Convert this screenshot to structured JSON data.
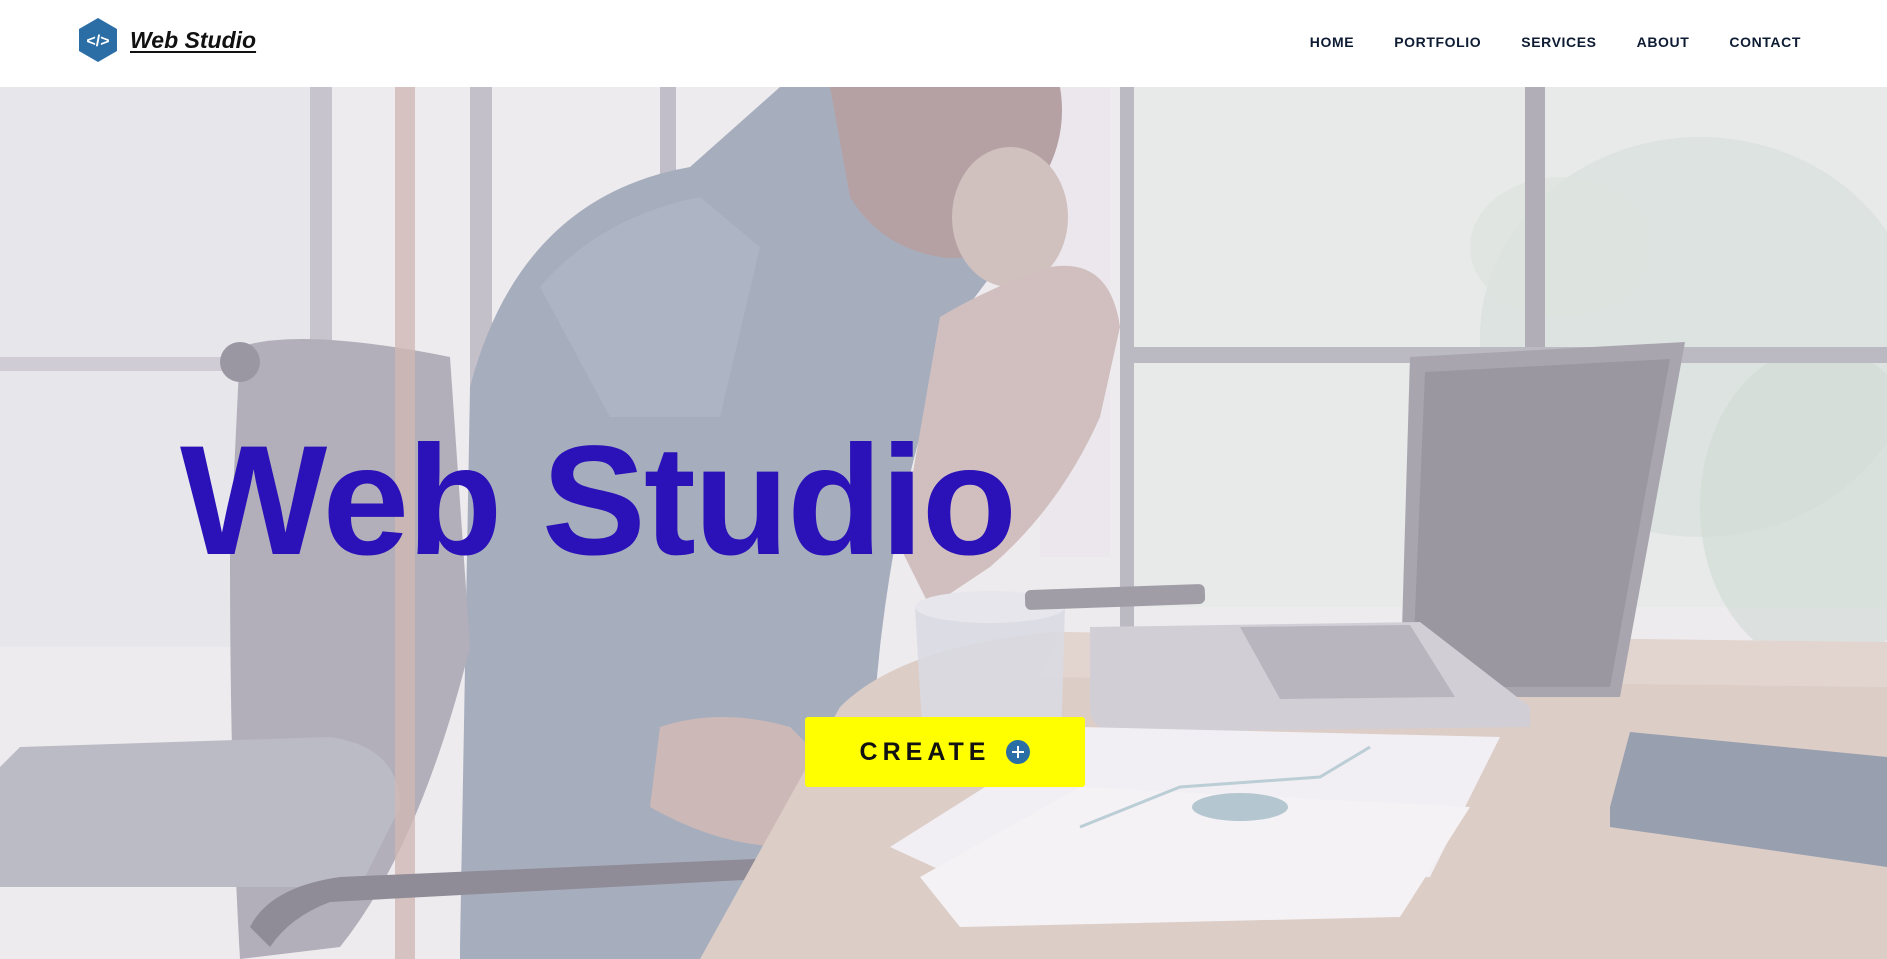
{
  "brand": {
    "name": "Web Studio",
    "logo_icon": "code-hexagon-icon",
    "logo_glyph": "</>"
  },
  "nav": {
    "items": [
      {
        "label": "HOME"
      },
      {
        "label": "PORTFOLIO"
      },
      {
        "label": "SERVICES"
      },
      {
        "label": "ABOUT"
      },
      {
        "label": "CONTACT"
      }
    ]
  },
  "hero": {
    "title": "Web Studio",
    "cta_label": "CREATE",
    "cta_icon": "plus-circle-icon"
  },
  "colors": {
    "accent_blue": "#2a12b8",
    "logo_blue": "#2b6ea6",
    "cta_yellow": "#ffff00",
    "nav_text": "#0d1b33"
  }
}
